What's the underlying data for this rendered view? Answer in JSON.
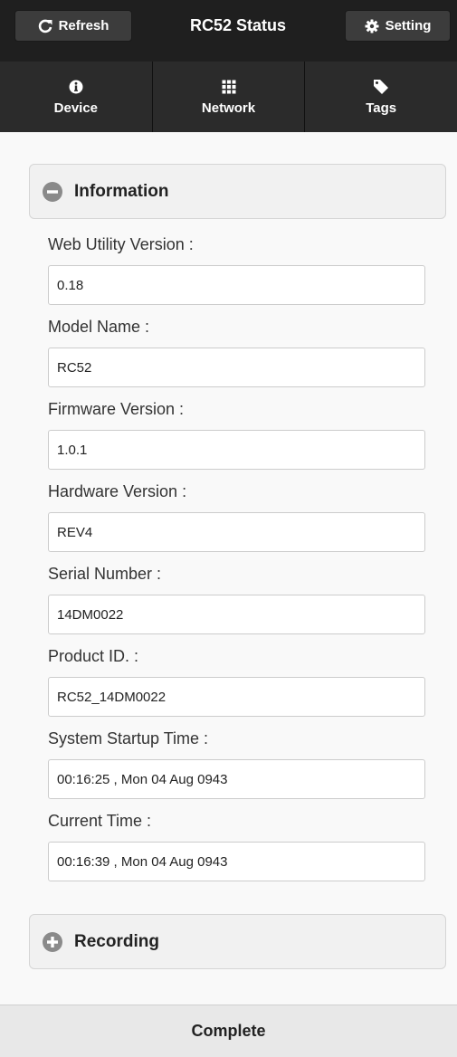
{
  "header": {
    "refresh_label": "Refresh",
    "title": "RC52 Status",
    "setting_label": "Setting"
  },
  "tabs": [
    {
      "label": "Device",
      "icon": "info-icon"
    },
    {
      "label": "Network",
      "icon": "grid-icon"
    },
    {
      "label": "Tags",
      "icon": "tag-icon"
    }
  ],
  "information": {
    "title": "Information",
    "fields": [
      {
        "label": "Web Utility Version :",
        "value": "0.18"
      },
      {
        "label": "Model Name :",
        "value": "RC52"
      },
      {
        "label": "Firmware Version :",
        "value": "1.0.1"
      },
      {
        "label": "Hardware Version :",
        "value": "REV4"
      },
      {
        "label": "Serial Number :",
        "value": "14DM0022"
      },
      {
        "label": "Product ID. :",
        "value": "RC52_14DM0022"
      },
      {
        "label": "System Startup Time :",
        "value": "00:16:25 , Mon 04 Aug 0943"
      },
      {
        "label": "Current Time :",
        "value": "00:16:39 , Mon 04 Aug 0943"
      }
    ]
  },
  "recording": {
    "title": "Recording"
  },
  "footer": {
    "status": "Complete"
  },
  "colors": {
    "header_bg": "#1f1f1f",
    "navbar_bg": "#2b2b2b",
    "button_bg": "#3c3c3c",
    "collapsible_icon": "#8a8a8a"
  }
}
